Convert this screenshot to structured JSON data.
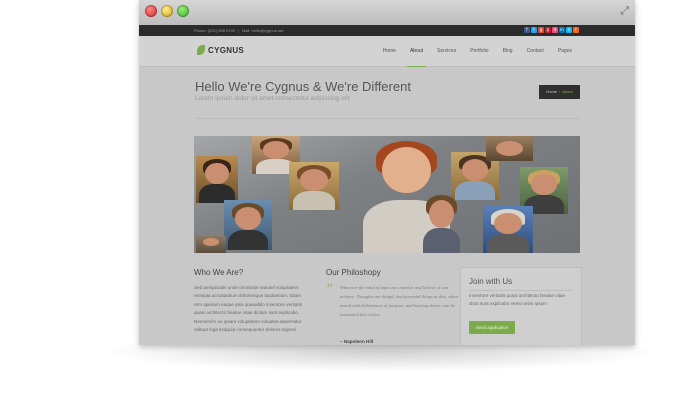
{
  "topbar": {
    "phone": "Phone: (021) 555 0199",
    "separator": "|",
    "email": "Mail: hello@cygnus.net",
    "social_icons": [
      {
        "icon": "facebook-icon",
        "glyph": "f",
        "color": "#3b5998"
      },
      {
        "icon": "twitter-icon",
        "glyph": "t",
        "color": "#1da1f2"
      },
      {
        "icon": "google-plus-icon",
        "glyph": "g",
        "color": "#dd4b39"
      },
      {
        "icon": "pinterest-icon",
        "glyph": "p",
        "color": "#cb2027"
      },
      {
        "icon": "dribbble-icon",
        "glyph": "d",
        "color": "#ea4c89"
      },
      {
        "icon": "linkedin-icon",
        "glyph": "in",
        "color": "#0077b5"
      },
      {
        "icon": "vimeo-icon",
        "glyph": "v",
        "color": "#1ab7ea"
      },
      {
        "icon": "rss-icon",
        "glyph": "r",
        "color": "#f26522"
      }
    ]
  },
  "brand": {
    "name": "CYGNUS",
    "accent": "#7cab4c"
  },
  "nav": {
    "items": [
      "Home",
      "About",
      "Services",
      "Portfolio",
      "Blog",
      "Contact",
      "Pages"
    ],
    "active": "About"
  },
  "page_header": {
    "title": "Hello We're Cygnus & We're Different",
    "subtitle": "Lorem ipsum dolor sit amet consectetur adipiscing elit",
    "breadcrumb": {
      "home": "Home",
      "separator": "/",
      "current": "About"
    }
  },
  "sections": {
    "who": {
      "title": "Who We Are?",
      "lines": [
        "Sed perspiciatis unde omnisiste natusel voluptatem",
        "remquia accusantium doloremque laudantium, totam",
        "rem aperiam eaque ipsa quaeabilo inventore veritatis",
        "quasi architecto beatae vitae dictam sunt explicabo.",
        "Nemoenim eu ipsam voluptatem voluptas aspernatur",
        "oditaut fugit sedquia consequuntur dolores eigend"
      ]
    },
    "philosophy": {
      "title": "Our Philoshopy",
      "quote_mark": "“",
      "quote": "Whatever the mind of man can conceive and believe, it can achieve. Thoughts are things! And powerful things at that, when mixed with definiteness of purpose, and burning desire, can be translated into riches.",
      "author": "– Napoleon Hill"
    },
    "join": {
      "title": "Join with Us",
      "text": "Inventore veritatis quasi architecto beatae vitae dicta sunt explicabo nemo enim ipsam",
      "button": "Send application"
    }
  }
}
